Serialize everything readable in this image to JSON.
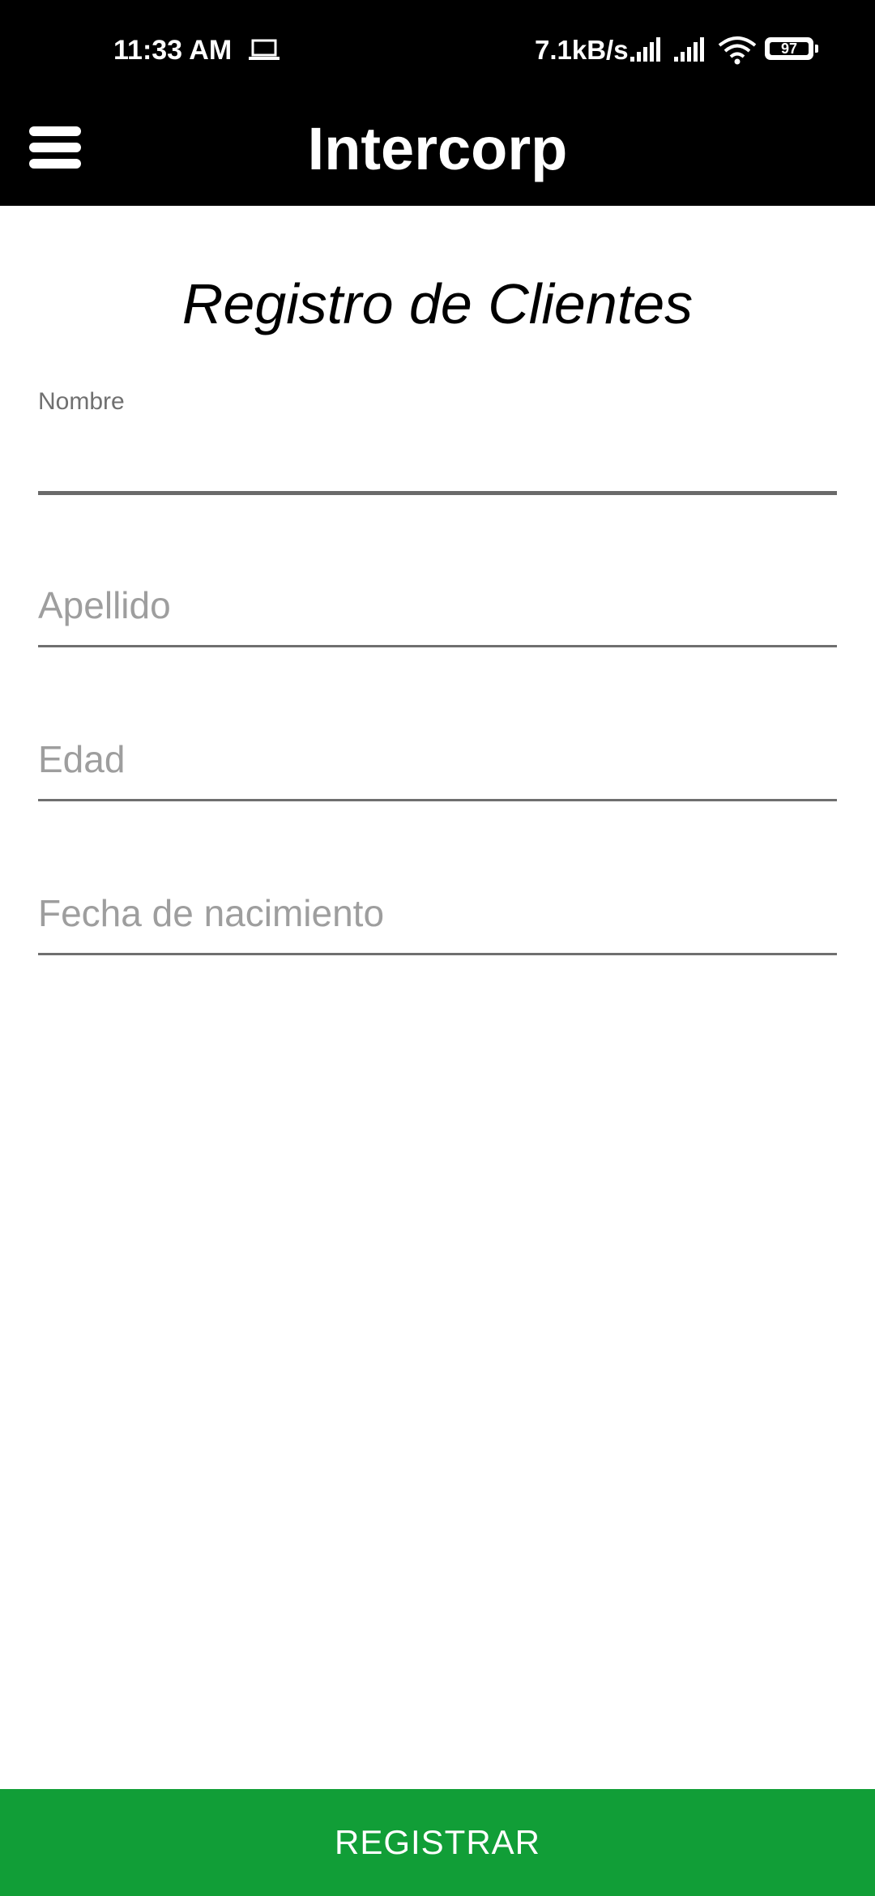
{
  "status_bar": {
    "time": "11:33 AM",
    "net_speed": "7.1kB/s",
    "battery": "97",
    "icons": [
      "laptop-icon",
      "signal-icon",
      "signal-icon",
      "wifi-icon",
      "battery-icon"
    ]
  },
  "app_bar": {
    "title": "Intercorp",
    "menu_icon": "hamburger-menu-icon"
  },
  "form": {
    "heading": "Registro de Clientes",
    "nombre": {
      "label": "Nombre",
      "value": ""
    },
    "apellido": {
      "placeholder": "Apellido",
      "value": ""
    },
    "edad": {
      "placeholder": "Edad",
      "value": ""
    },
    "fecha_nacimiento": {
      "placeholder": "Fecha de nacimiento",
      "value": ""
    }
  },
  "actions": {
    "register_label": "REGISTRAR"
  },
  "colors": {
    "app_bar_background": "#000000",
    "accent_green": "#119e37",
    "placeholder_gray": "#9e9e9e",
    "label_gray": "#707070"
  }
}
